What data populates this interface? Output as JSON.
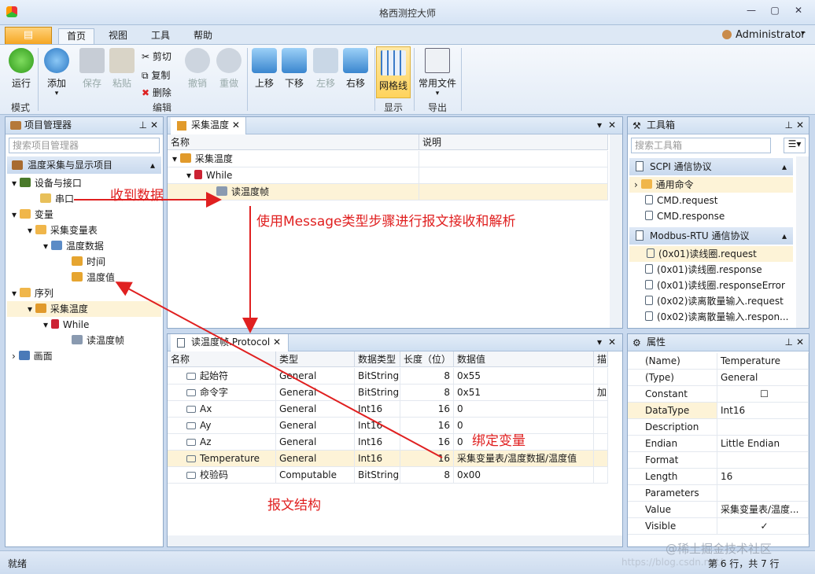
{
  "window": {
    "title": "格西测控大师",
    "user": "Administrator"
  },
  "ribbon": {
    "tabs": [
      "首页",
      "视图",
      "工具",
      "帮助"
    ],
    "run": "运行",
    "add": "添加",
    "save": "保存",
    "paste": "粘贴",
    "cut": "剪切",
    "copy": "复制",
    "delete": "删除",
    "undo": "撤销",
    "redo": "重做",
    "up": "上移",
    "down": "下移",
    "left": "左移",
    "right": "右移",
    "gridline": "网格线",
    "common_files": "常用文件",
    "groups": {
      "mode": "模式",
      "edit": "编辑",
      "display": "显示",
      "export": "导出"
    }
  },
  "project": {
    "title": "项目管理器",
    "search_placeholder": "搜索项目管理器",
    "section": "温度采集与显示项目",
    "tree": [
      "设备与接口",
      "串口",
      "变量",
      "采集变量表",
      "温度数据",
      "时间",
      "温度值",
      "序列",
      "采集温度",
      "While",
      "读温度帧",
      "画面"
    ]
  },
  "sequence": {
    "tab": "采集温度",
    "col_name": "名称",
    "col_desc": "说明",
    "rows": [
      "采集温度",
      "While",
      "读温度帧"
    ]
  },
  "protocol": {
    "tab": "读温度帧.Protocol",
    "columns": [
      "名称",
      "类型",
      "数据类型",
      "长度（位）",
      "数据值",
      "描"
    ],
    "rows": [
      {
        "name": "起始符",
        "type": "General",
        "dtype": "BitString",
        "len": "8",
        "val": "0x55",
        "desc": ""
      },
      {
        "name": "命令字",
        "type": "General",
        "dtype": "BitString",
        "len": "8",
        "val": "0x51",
        "desc": "加"
      },
      {
        "name": "Ax",
        "type": "General",
        "dtype": "Int16",
        "len": "16",
        "val": "0",
        "desc": ""
      },
      {
        "name": "Ay",
        "type": "General",
        "dtype": "Int16",
        "len": "16",
        "val": "0",
        "desc": ""
      },
      {
        "name": "Az",
        "type": "General",
        "dtype": "Int16",
        "len": "16",
        "val": "0",
        "desc": ""
      },
      {
        "name": "Temperature",
        "type": "General",
        "dtype": "Int16",
        "len": "16",
        "val": "采集变量表/温度数据/温度值",
        "desc": ""
      },
      {
        "name": "校验码",
        "type": "Computable",
        "dtype": "BitString",
        "len": "8",
        "val": "0x00",
        "desc": ""
      }
    ]
  },
  "toolbox": {
    "title": "工具箱",
    "search_placeholder": "搜索工具箱",
    "sections": [
      "SCPI 通信协议",
      "Modbus-RTU 通信协议"
    ],
    "scpi": [
      "通用命令",
      "CMD.request",
      "CMD.response"
    ],
    "modbus": [
      "(0x01)读线圈.request",
      "(0x01)读线圈.response",
      "(0x01)读线圈.responseError",
      "(0x02)读离散量输入.request",
      "(0x02)读离散量输入.respon..."
    ]
  },
  "properties": {
    "title": "属性",
    "rows": [
      {
        "k": "(Name)",
        "v": "Temperature"
      },
      {
        "k": "(Type)",
        "v": "General"
      },
      {
        "k": "Constant",
        "v": ""
      },
      {
        "k": "DataType",
        "v": "Int16"
      },
      {
        "k": "Description",
        "v": ""
      },
      {
        "k": "Endian",
        "v": "Little Endian"
      },
      {
        "k": "Format",
        "v": ""
      },
      {
        "k": "Length",
        "v": "16"
      },
      {
        "k": "Parameters",
        "v": ""
      },
      {
        "k": "Value",
        "v": "采集变量表/温度..."
      },
      {
        "k": "Visible",
        "v": "✓"
      }
    ]
  },
  "annotations": {
    "recv": "收到数据",
    "message": "使用Message类型步骤进行报文接收和解析",
    "bind": "绑定变量",
    "struct": "报文结构"
  },
  "status": {
    "left": "就绪",
    "right": "第 6 行，共 7 行",
    "watermark": "@稀土掘金技术社区",
    "url": "https://blog.csdn.net/"
  }
}
